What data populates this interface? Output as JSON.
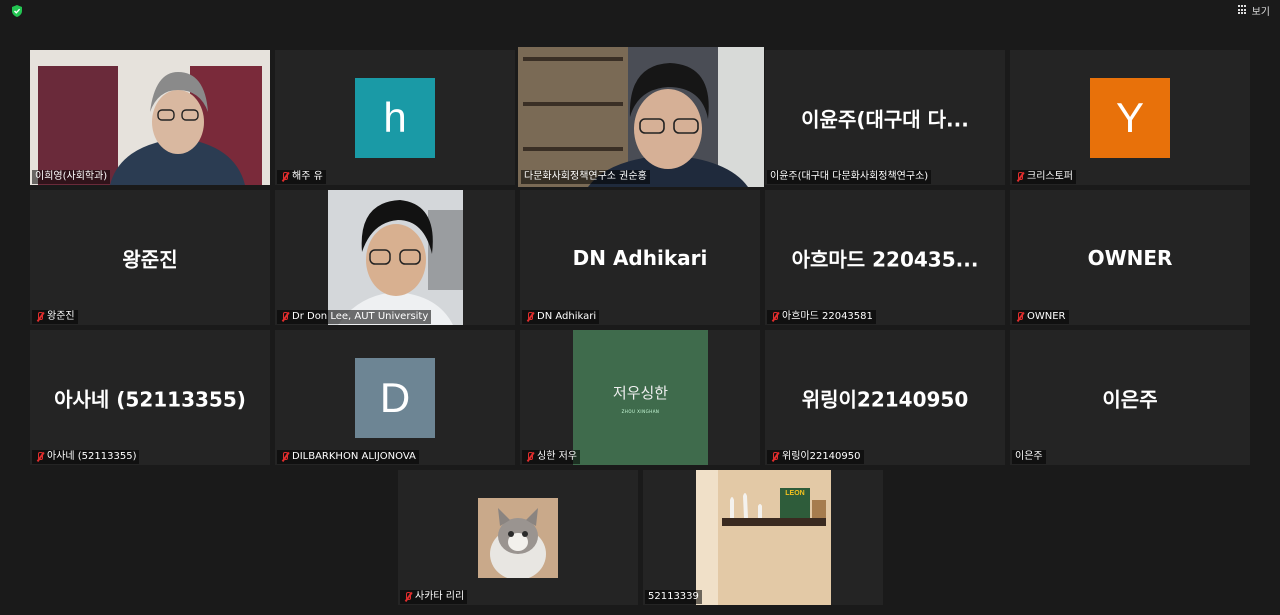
{
  "toolbar": {
    "view_label": "보기"
  },
  "icons": {
    "security": "shield-check-icon",
    "view": "grid-icon",
    "mic_muted": "mic-muted-icon"
  },
  "colors": {
    "active_speaker_border": "#c9e04c",
    "muted_icon": "#e02d2d",
    "tile_bg": "#242424"
  },
  "participants": [
    {
      "label": "이희영(사회학과)",
      "muted": false
    },
    {
      "label": "해주 유",
      "muted": true,
      "avatar_letter": "h",
      "avatar_color": "#1a9aa6"
    },
    {
      "label": "다문화사회정책연구소 권순홍",
      "muted": false,
      "active_speaker": true
    },
    {
      "label": "이윤주(대구대 다문화사회정책연구소)",
      "muted": false,
      "display_name": "이윤주(대구대 다..."
    },
    {
      "label": "크리스토퍼",
      "muted": true,
      "avatar_letter": "Y",
      "avatar_color": "#e8710a"
    },
    {
      "label": "왕준진",
      "muted": true,
      "display_name": "왕준진"
    },
    {
      "label": "Dr Don Lee, AUT University",
      "muted": true
    },
    {
      "label": "DN Adhikari",
      "muted": true,
      "display_name": "DN Adhikari"
    },
    {
      "label": "아흐마드 22043581",
      "muted": true,
      "display_name": "아흐마드 220435..."
    },
    {
      "label": "OWNER",
      "muted": true,
      "display_name": "OWNER"
    },
    {
      "label": "아사네 (52113355)",
      "muted": true,
      "display_name": "아사네 (52113355)"
    },
    {
      "label": "DILBARKHON ALIJONOVA",
      "muted": true,
      "avatar_letter": "D",
      "avatar_color": "#6d8594"
    },
    {
      "label": "싱한 저우",
      "muted": true,
      "card_text": "저우싱한",
      "card_subtext": "ZHOU XINGHAN"
    },
    {
      "label": "위링이22140950",
      "muted": true,
      "display_name": "위링이22140950"
    },
    {
      "label": "이은주",
      "muted": false,
      "display_name": "이은주"
    },
    {
      "label": "사카타 리리",
      "muted": true
    },
    {
      "label": "52113339",
      "muted": false,
      "photo_text": "LEON"
    }
  ]
}
